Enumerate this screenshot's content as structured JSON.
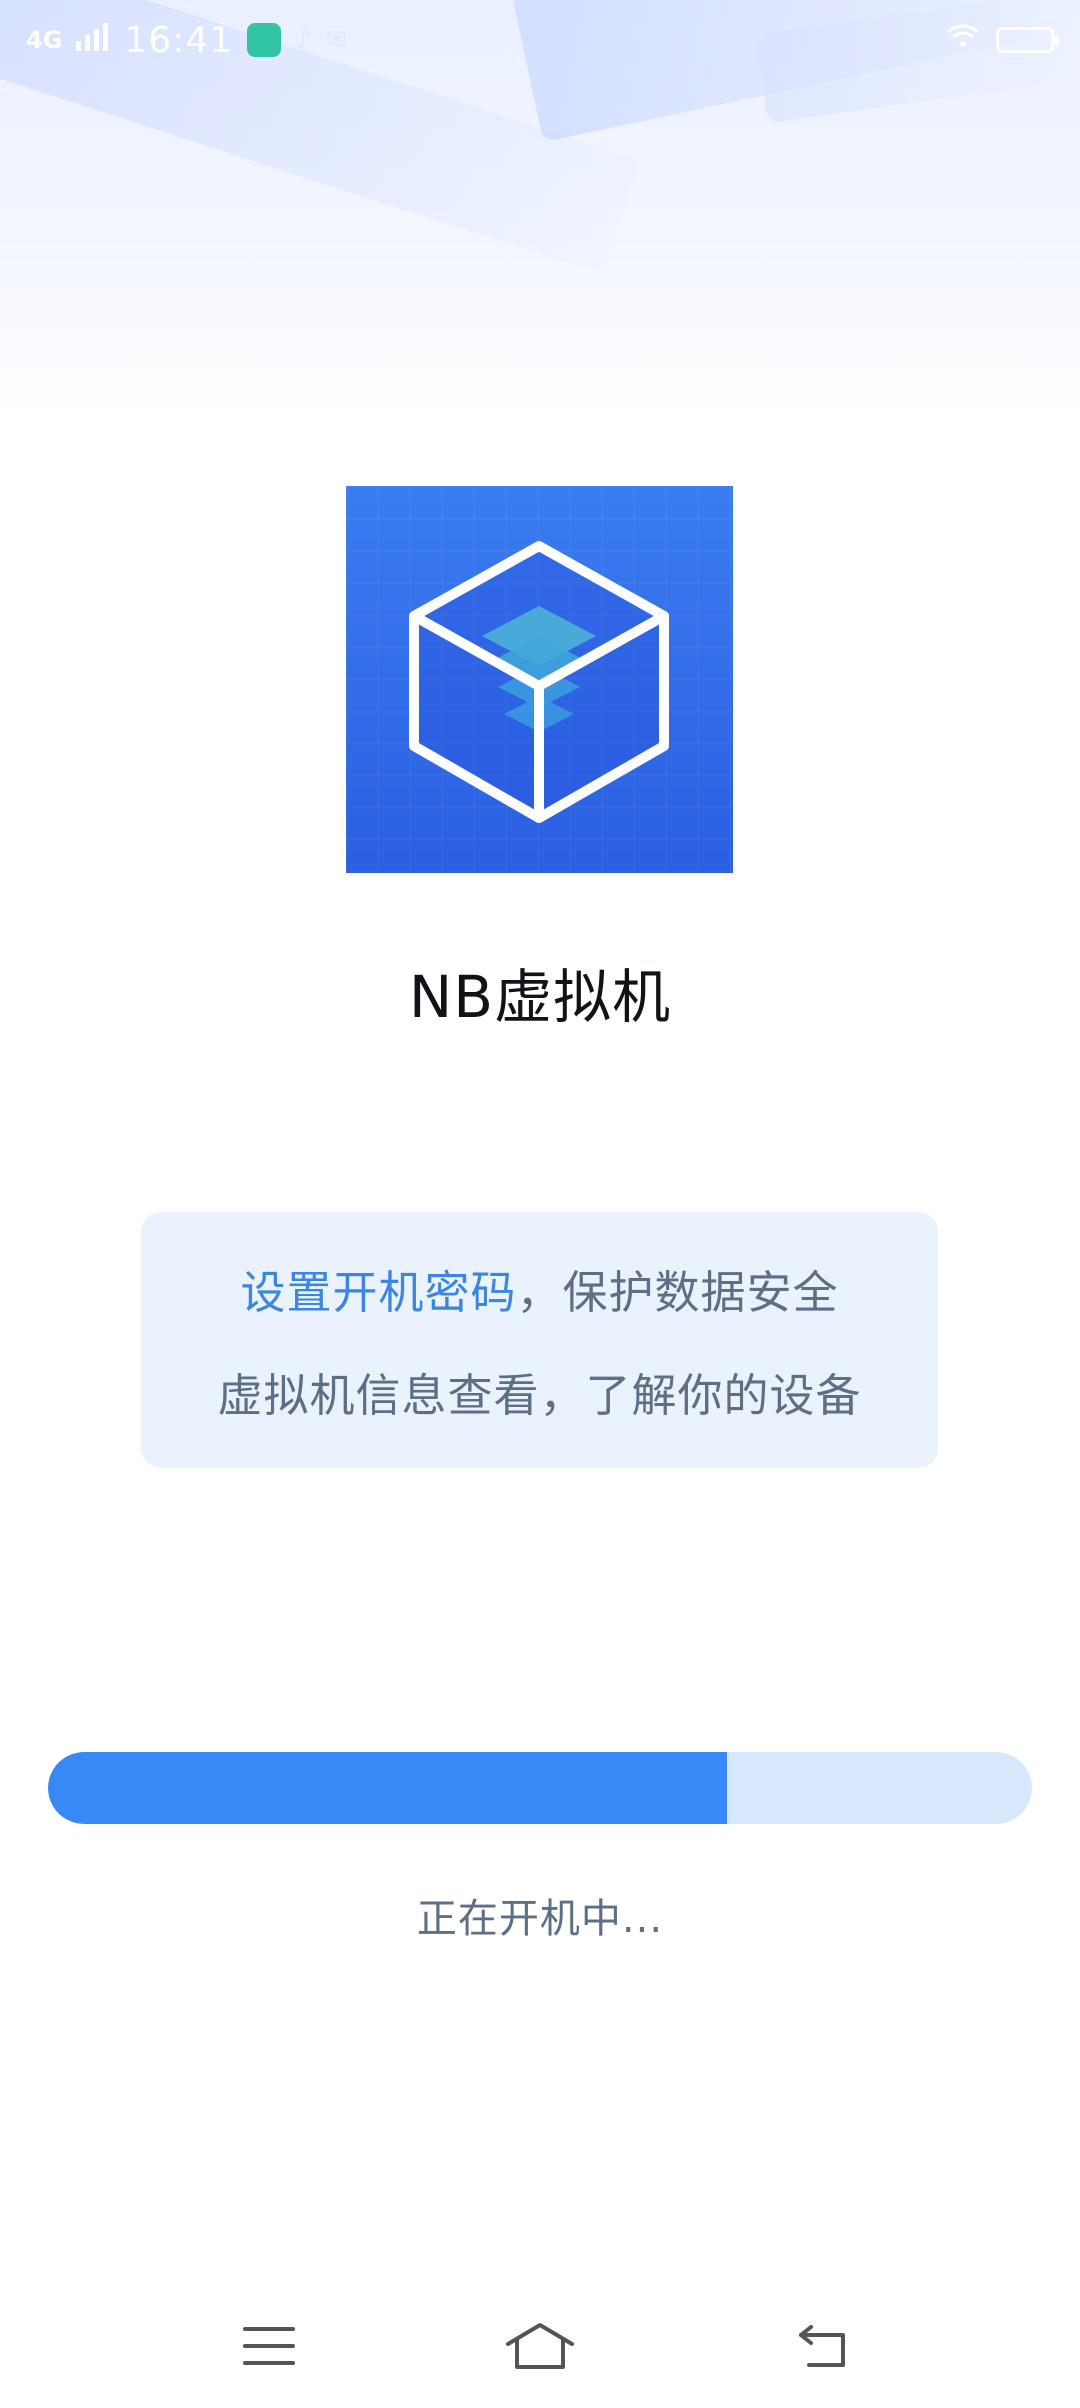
{
  "status_bar": {
    "network": "4G",
    "time": "16:41",
    "battery_level": "100"
  },
  "app": {
    "name": "NB虚拟机",
    "logo_icon": "virtual-machine-cube-icon"
  },
  "info_card": {
    "line1_highlight": "设置开机密码",
    "line1_rest": "，保护数据安全",
    "line2": "虚拟机信息查看，了解你的设备"
  },
  "progress": {
    "value": 0.69,
    "label": "正在开机中..."
  },
  "nav_bar": {
    "menu_icon": "menu-icon",
    "home_icon": "home-icon",
    "back_icon": "back-icon"
  },
  "colors": {
    "accent": "#3889f5",
    "track": "#d8e7fb",
    "card_bg": "#e9f2fd",
    "highlight_text": "#3b86de",
    "body_text": "#5c6f87",
    "logo_bg": "#2f6de8"
  }
}
